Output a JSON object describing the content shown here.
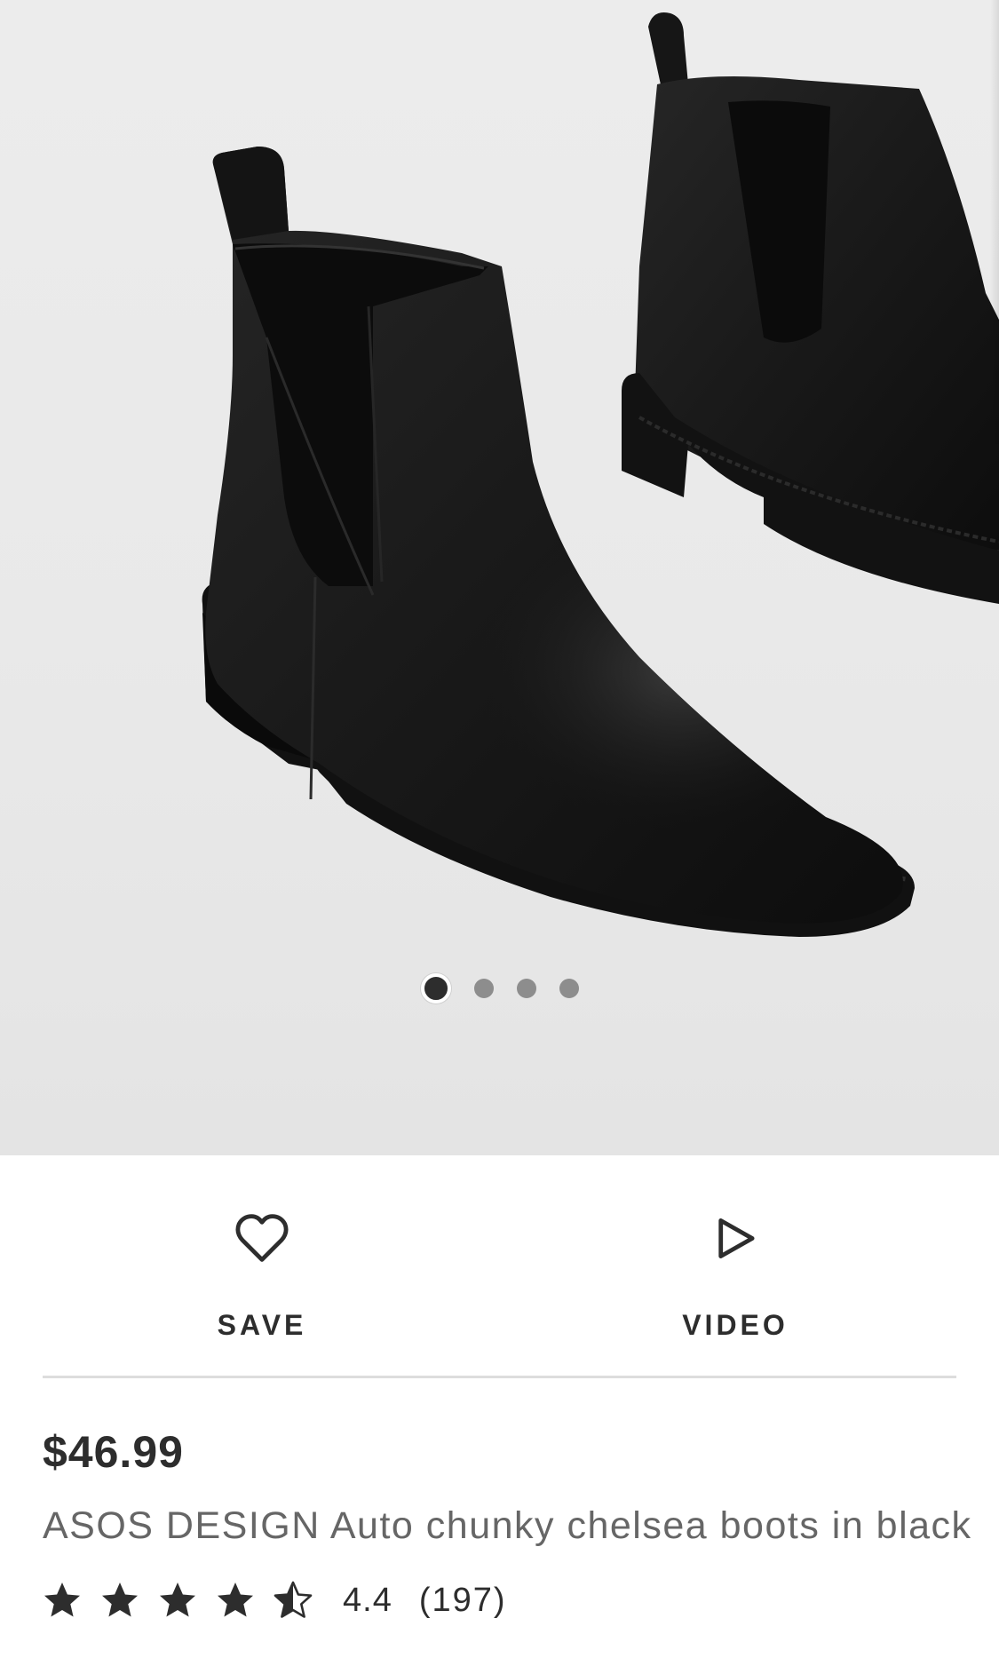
{
  "gallery": {
    "image_alt": "Black chunky chelsea boots",
    "total_images": 4,
    "active_index": 0
  },
  "actions": {
    "save_label": "SAVE",
    "save_icon": "heart-icon",
    "video_label": "VIDEO",
    "video_icon": "play-icon"
  },
  "product": {
    "price": "$46.99",
    "name": "ASOS DESIGN Auto chunky chelsea boots in black",
    "rating_value": "4.4",
    "rating_count": "(197)",
    "rating_stars": 4.5,
    "star_color": "#2d2d2d"
  }
}
